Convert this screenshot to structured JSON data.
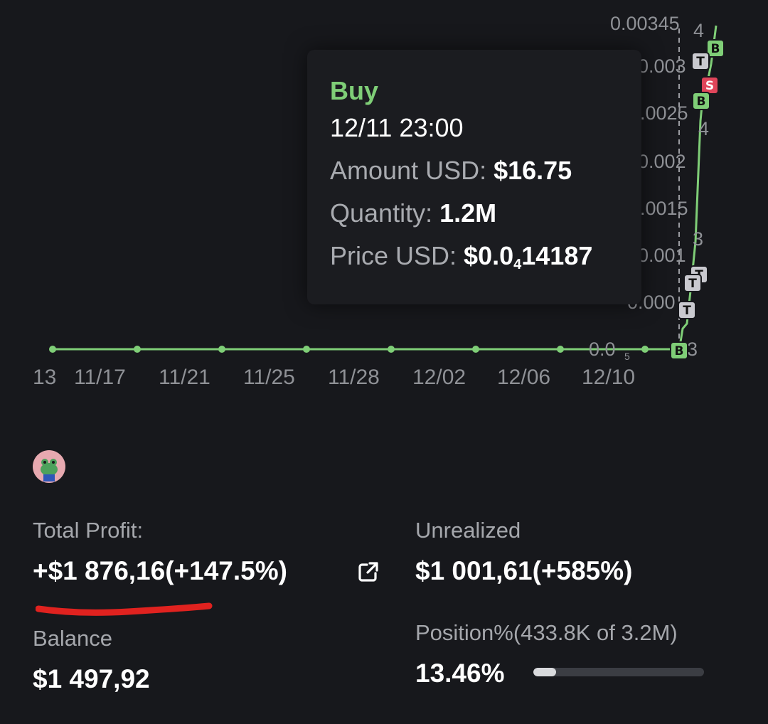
{
  "chart": {
    "x_ticks": [
      "13",
      "11/17",
      "11/21",
      "11/25",
      "11/28",
      "12/02",
      "12/06",
      "12/10"
    ],
    "y_ticks": [
      "0.00345",
      "0.003",
      ".0025",
      "0.002",
      ".0015",
      "0.001",
      "0.000",
      "0.0",
      "4",
      "3",
      "3",
      "4"
    ],
    "y_tick_subscript": "5",
    "markers": [
      "B",
      "T",
      "S",
      "B",
      "T",
      "T",
      "T",
      "B"
    ],
    "line_color": "#7fce77",
    "buy_color": "#7fce77",
    "sell_color": "#e0455a",
    "transfer_color": "#c9c9cf"
  },
  "tooltip": {
    "type": "Buy",
    "datetime": "12/11 23:00",
    "amount_label": "Amount USD:",
    "amount_value": "$16.75",
    "quantity_label": "Quantity:",
    "quantity_value": "1.2M",
    "price_label": "Price USD:",
    "price_prefix": "$0.0",
    "price_sub": "4",
    "price_rest": "14187"
  },
  "user": {
    "avatar_icon": "frog-avatar-icon"
  },
  "stats": {
    "total_profit_label": "Total Profit:",
    "total_profit_value": "+$1 876,16(+147.5%)",
    "unrealized_label": "Unrealized",
    "unrealized_value": "$1 001,61(+585%)",
    "balance_label": "Balance",
    "balance_value": "$1 497,92",
    "position_label": "Position%(433.8K of 3.2M)",
    "position_value": "13.46%",
    "position_fraction": 0.1346,
    "annotation_color": "#e0221f"
  }
}
